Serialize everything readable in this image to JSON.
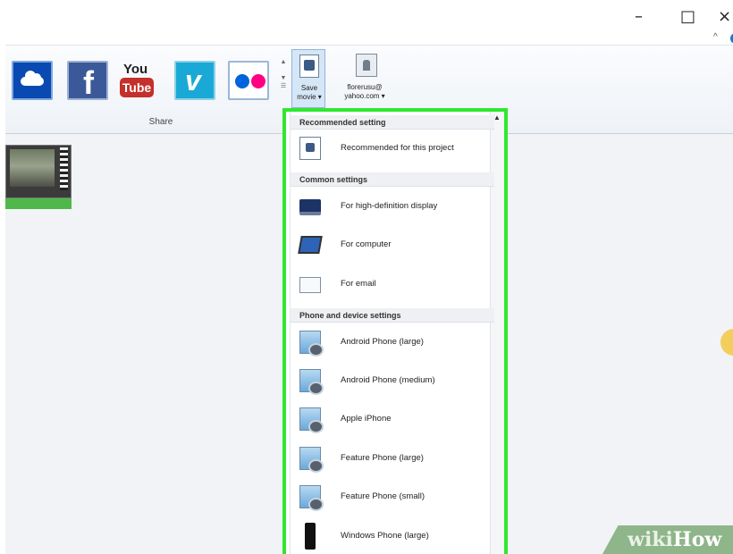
{
  "window": {
    "minimize_glyph": "–",
    "maximize_glyph": "□",
    "close_glyph": "×"
  },
  "ribbon": {
    "share_group": {
      "caption": "Share",
      "tiles": [
        {
          "name": "onedrive",
          "icon": "cloud-icon",
          "color": "#094ab2"
        },
        {
          "name": "facebook",
          "text": "f",
          "color": "#3b5998"
        },
        {
          "name": "youtube",
          "text_top": "You",
          "text_bottom": "Tube",
          "color": "#c4302b"
        },
        {
          "name": "vimeo",
          "text": "v",
          "color": "#1aa9d6"
        },
        {
          "name": "flickr",
          "icon": "flickr-dots-icon",
          "color": "#0063dc"
        }
      ]
    },
    "save_movie": {
      "line1": "Save",
      "line2": "movie ▾"
    },
    "account": {
      "line1": "florerusu@",
      "line2": "yahoo.com ▾"
    }
  },
  "menu": {
    "sections": [
      {
        "header": "Recommended setting",
        "items": [
          {
            "label": "Recommended for this project",
            "icon": "project-icon"
          }
        ]
      },
      {
        "header": "Common settings",
        "items": [
          {
            "label": "For high-definition display",
            "icon": "hd-display-icon"
          },
          {
            "label": "For computer",
            "icon": "computer-icon"
          },
          {
            "label": "For email",
            "icon": "email-icon"
          }
        ]
      },
      {
        "header": "Phone and device settings",
        "items": [
          {
            "label": "Android Phone (large)",
            "icon": "phone-icon"
          },
          {
            "label": "Android Phone (medium)",
            "icon": "phone-icon"
          },
          {
            "label": "Apple iPhone",
            "icon": "phone-icon"
          },
          {
            "label": "Feature Phone (large)",
            "icon": "phone-icon"
          },
          {
            "label": "Feature Phone (small)",
            "icon": "phone-icon"
          },
          {
            "label": "Windows Phone (large)",
            "icon": "windows-phone-icon"
          }
        ]
      }
    ],
    "highlight_color": "#2ee82e"
  },
  "watermark": {
    "part1": "wiki",
    "part2": "How"
  }
}
